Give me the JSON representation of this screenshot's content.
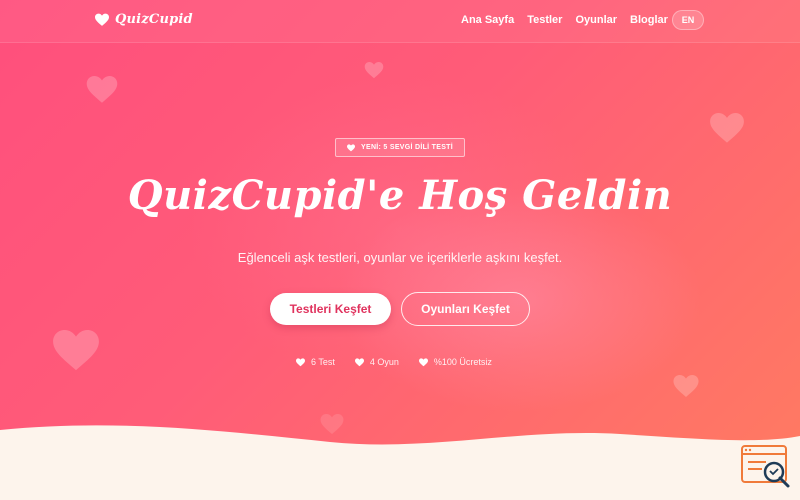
{
  "brand": {
    "name": "QuizCupid"
  },
  "nav": {
    "links": [
      "Ana Sayfa",
      "Testler",
      "Oyunlar",
      "Bloglar"
    ],
    "language": "EN"
  },
  "hero": {
    "badge": "YENİ: 5 SEVGİ DİLİ TESTİ",
    "title": "QuizCupid'e Hoş Geldin",
    "subtitle": "Eğlenceli aşk testleri, oyunlar ve içeriklerle aşkını keşfet.",
    "primary_button": "Testleri Keşfet",
    "secondary_button": "Oyunları Keşfet",
    "stats": [
      "6 Test",
      "4 Oyun",
      "%100 Ücretsiz"
    ]
  },
  "icons": {
    "logo": "heart-icon",
    "badge": "heart-icon",
    "stat": "heart-icon",
    "corner": "search-icon"
  },
  "colors": {
    "gradient_start": "#ff4f7d",
    "gradient_end": "#ff7a62",
    "primary_button_text": "#e0335e",
    "wave": "#fdf4ec",
    "corner_widget": "#f07a3a"
  }
}
